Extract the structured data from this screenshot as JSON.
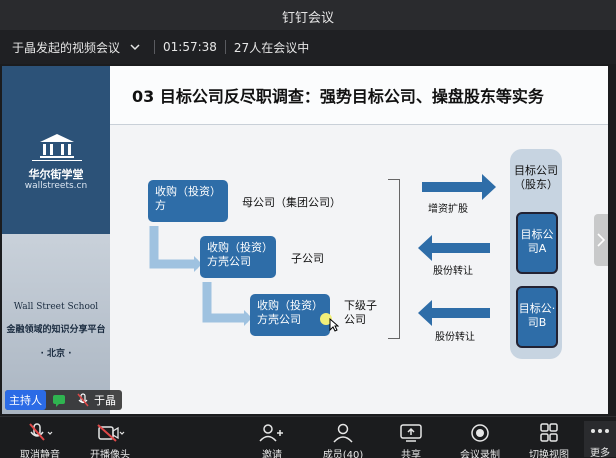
{
  "app": {
    "title": "钉钉会议"
  },
  "meeting": {
    "name": "于晶发起的视频会议",
    "elapsed": "01:57:38",
    "participants": "27人在会议中"
  },
  "slide": {
    "title": "03 目标公司反尽职调查：强势目标公司、操盘股东等实务",
    "brand_cn": "华尔街学堂",
    "brand_en": "wallstreets.cn",
    "school_en": "Wall Street School",
    "school_cn": "金融领域的知识分享平台",
    "school_city": "· 北京 ·",
    "box1": "收购（投资）方",
    "box2": "收购（投资）方壳公司",
    "box3": "收购（投资）方壳公司",
    "label_mother": "母公司（集团公司）",
    "label_sub": "子公司",
    "label_lower": "下级子公司",
    "label_increase": "增资扩股",
    "label_share1": "股份转让",
    "label_share2": "股份转让",
    "target_head": "目标公司（股东）",
    "target_a": "目标公司A",
    "target_b": "目标公·司B"
  },
  "participant": {
    "host_label": "主持人",
    "name": "于晶"
  },
  "toolbar": {
    "mic": "取消静音",
    "camera": "开播像头",
    "invite": "邀请",
    "members": "成员(40)",
    "share": "共享",
    "record": "会议录制",
    "view": "切换视图",
    "more": "更多"
  },
  "colors": {
    "accent_box": "#2e6da8",
    "slide_panel": "#2c5278",
    "host_badge": "#2b6be6",
    "muted_red": "#e04848"
  }
}
